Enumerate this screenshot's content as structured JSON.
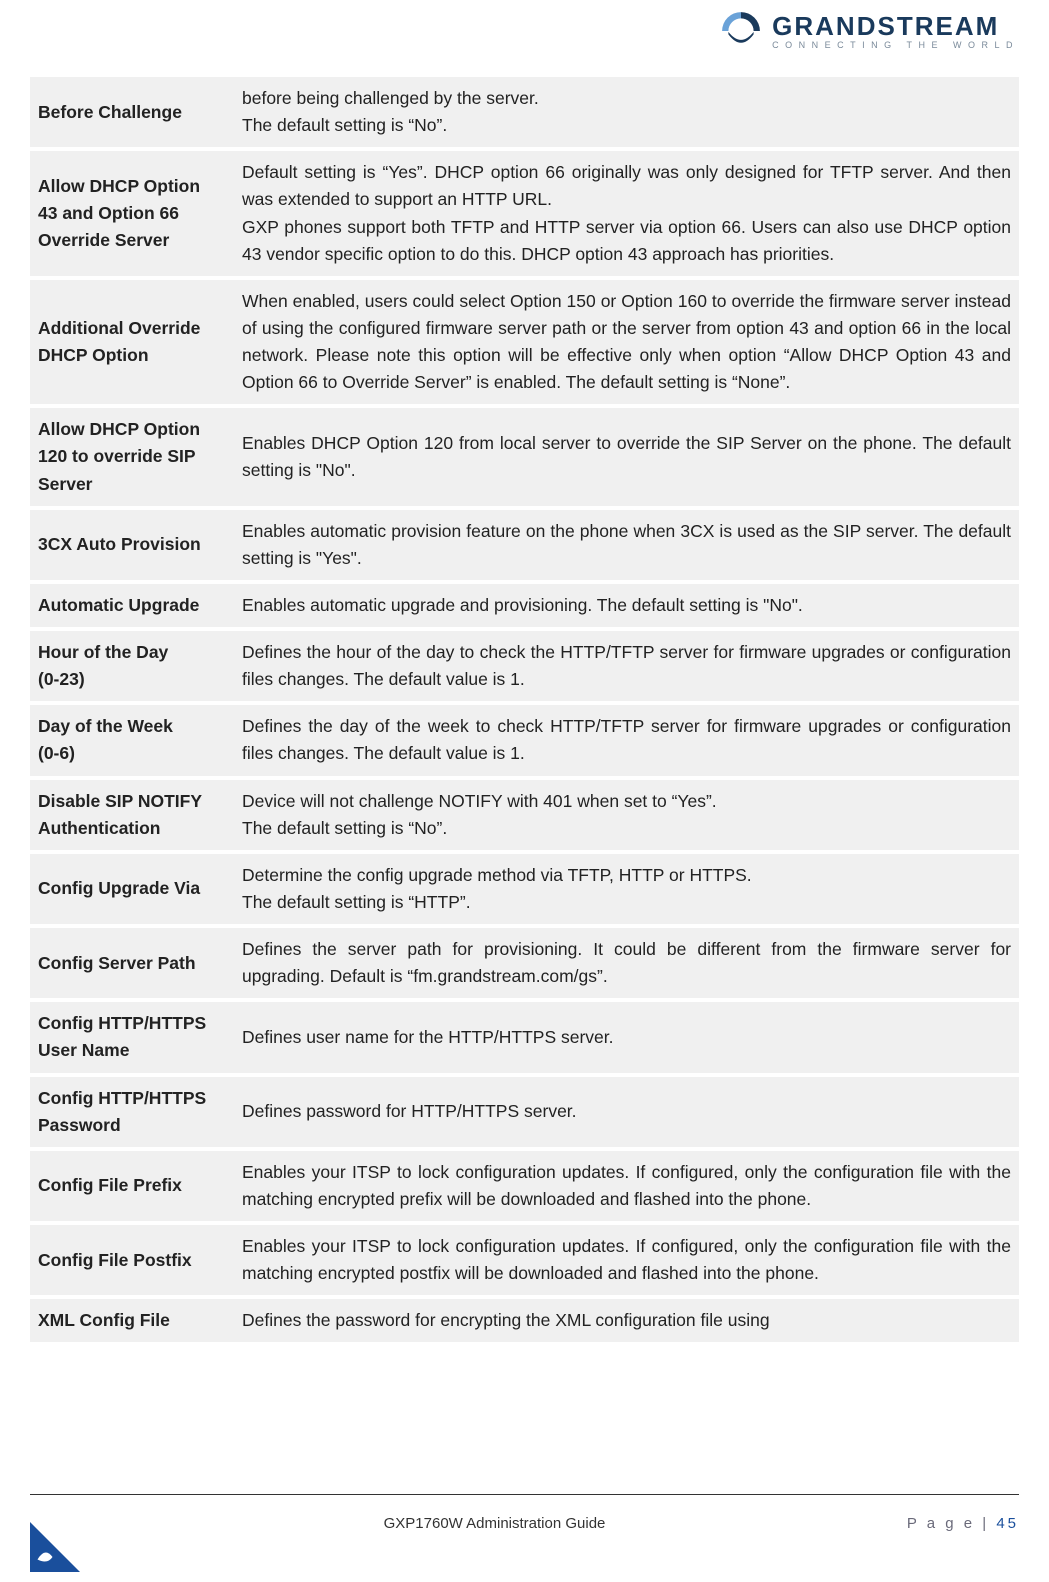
{
  "header": {
    "brand": "GRANDSTREAM",
    "tagline": "CONNECTING THE WORLD"
  },
  "rows": [
    {
      "term": "Before Challenge",
      "desc": "before being challenged by the server.\nThe default setting is “No”.",
      "justify": false
    },
    {
      "term": "Allow DHCP Option 43 and Option 66 Override Server",
      "desc": "Default setting is “Yes”. DHCP option 66 originally was only designed for TFTP server. And then was extended to support an HTTP URL.\nGXP phones support both TFTP and HTTP server via option 66. Users can also use DHCP option 43 vendor specific option to do this. DHCP option 43 approach has priorities.",
      "justify": true
    },
    {
      "term": "Additional Override DHCP Option",
      "desc": "When enabled, users could select Option 150 or Option 160 to override the firmware server instead of using the configured firmware server path or the server from option 43 and option 66 in the local network. Please note this option will be effective only when option “Allow DHCP Option 43 and Option 66 to Override Server” is enabled. The default setting is “None”.",
      "justify": true
    },
    {
      "term": "Allow DHCP Option 120 to override SIP Server",
      "desc": "Enables DHCP Option 120 from local server to override the SIP Server on the phone. The default setting is \"No\".",
      "justify": true
    },
    {
      "term": "3CX Auto Provision",
      "desc": "Enables automatic provision feature on the phone when 3CX is used as the SIP server. The default setting is \"Yes\".",
      "justify": true
    },
    {
      "term": "Automatic Upgrade",
      "desc": "Enables automatic upgrade and provisioning. The default setting is \"No\".",
      "justify": false
    },
    {
      "term": "Hour of the Day\n(0-23)",
      "desc": "Defines the hour of the day to check the HTTP/TFTP server for firmware upgrades or configuration files changes. The default value is 1.",
      "justify": true
    },
    {
      "term": "Day of the Week\n(0-6)",
      "desc": "Defines the day of the week to check HTTP/TFTP server for firmware upgrades or configuration files changes. The default value is 1.",
      "justify": true
    },
    {
      "term": "Disable SIP NOTIFY Authentication",
      "desc": "Device will not challenge NOTIFY with 401 when set to “Yes”.\nThe default setting is “No”.",
      "justify": false
    },
    {
      "term": "Config Upgrade Via",
      "desc": "Determine the config upgrade method via TFTP, HTTP or HTTPS.\nThe default setting is “HTTP”.",
      "justify": false
    },
    {
      "term": "Config Server Path",
      "desc": "Defines the server path for provisioning. It could be different from the firmware server for upgrading. Default is “fm.grandstream.com/gs”.",
      "justify": true
    },
    {
      "term": "Config HTTP/HTTPS User Name",
      "desc": "Defines user name for the HTTP/HTTPS server.",
      "justify": false
    },
    {
      "term": "Config HTTP/HTTPS Password",
      "desc": "Defines password for HTTP/HTTPS server.",
      "justify": false
    },
    {
      "term": "Config File Prefix",
      "desc": "Enables your ITSP to lock configuration updates. If configured, only the configuration file with the matching encrypted prefix will be downloaded and flashed into the phone.",
      "justify": true
    },
    {
      "term": "Config File Postfix",
      "desc": "Enables your ITSP to lock configuration updates. If configured, only the configuration file with the matching encrypted postfix will be downloaded and flashed into the phone.",
      "justify": true
    },
    {
      "term": "XML Config File",
      "desc": "Defines the password for encrypting the XML configuration file using",
      "justify": true
    }
  ],
  "footer": {
    "guide": "GXP1760W Administration Guide",
    "page_label": "P a g e  | ",
    "page_number": "45"
  }
}
